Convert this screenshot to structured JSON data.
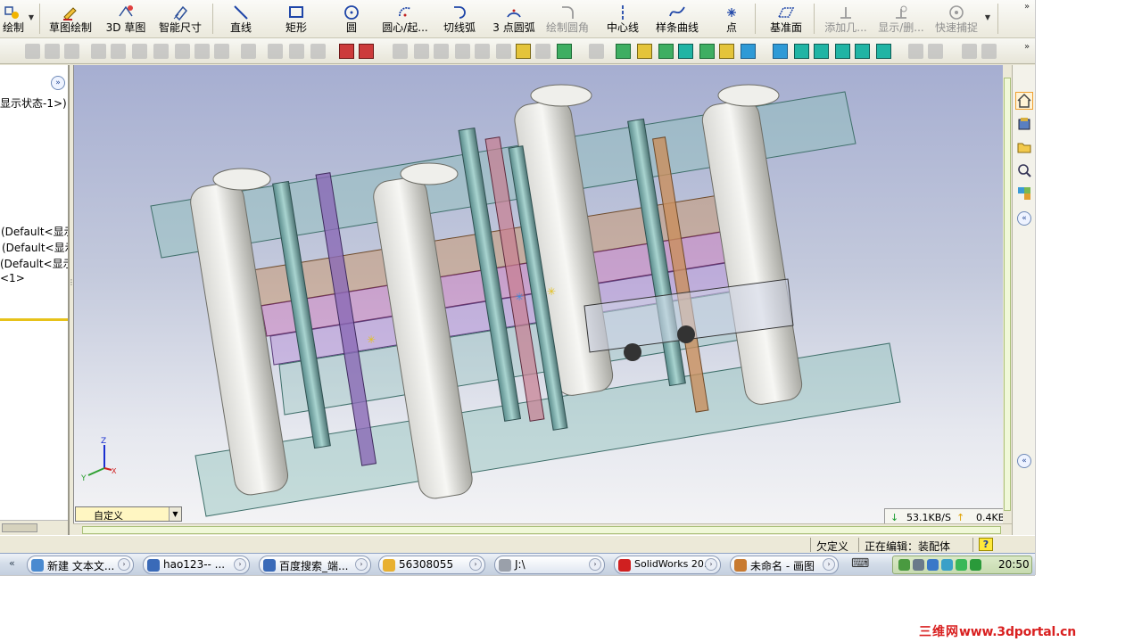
{
  "toolbar_sketch": {
    "sketch": "绘制",
    "sketch_draw": "草图绘制",
    "sketch_3d": "3D 草图",
    "smart_dim": "智能尺寸",
    "line": "直线",
    "rect": "矩形",
    "circle": "圆",
    "center_arc": "圆心/起...",
    "tangent_arc": "切线弧",
    "three_point_arc": "3 点圆弧",
    "fillet": "绘制圆角",
    "centerline": "中心线",
    "spline": "样条曲线",
    "point": "点",
    "plane": "基准面",
    "add_relation": "添加几...",
    "display_delete": "显示/删...",
    "quick_snap": "快速捕捉"
  },
  "feature_tree": {
    "display_state": "显示状态-1>)",
    "default_1": "(Default<显示",
    "default_2": "(Default<显示",
    "default_3": "(Default<显示",
    "item_4": "<1>"
  },
  "viewport": {
    "configuration": "自定义",
    "triad_z": "Z",
    "triad_y": "Y",
    "triad_x": "X"
  },
  "net_speed": {
    "download": "53.1KB/S",
    "upload": "0.4KB/S"
  },
  "status": {
    "defined": "欠定义",
    "editing": "正在编辑：装配体",
    "help": "?"
  },
  "taskbar": {
    "items": [
      "新建 文本文...",
      "hao123-- ...",
      "百度搜索_端...",
      "56308055",
      "J:\\",
      "SolidWorks 20...",
      "未命名 - 画图"
    ],
    "clock": "20:50"
  },
  "watermark": {
    "cn": "三维网",
    "url": "www.3dportal.cn"
  },
  "colors": {
    "accent": "#2c4f9a",
    "highlight": "#f0a030",
    "watermark": "#d92020"
  }
}
